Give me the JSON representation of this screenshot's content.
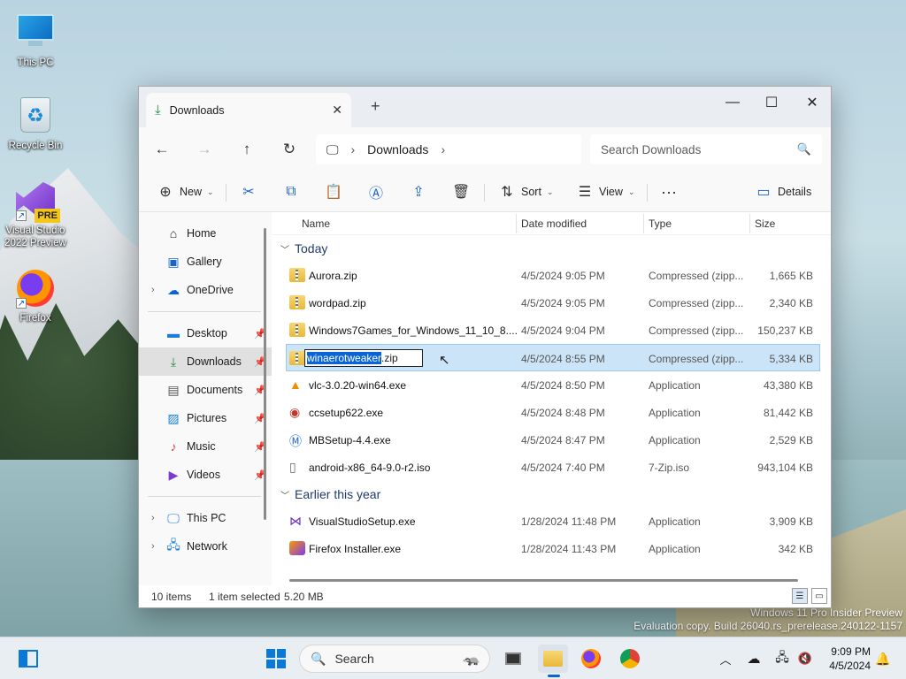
{
  "desktop": {
    "icons": [
      {
        "label": "This PC"
      },
      {
        "label": "Recycle Bin"
      },
      {
        "label": "Visual Studio 2022 Preview",
        "badge": "PRE"
      },
      {
        "label": "Firefox"
      }
    ],
    "watermark": {
      "line1": "Windows 11 Pro Insider Preview",
      "line2": "Evaluation copy. Build 26040.rs_prerelease.240122-1157"
    }
  },
  "window": {
    "tab_title": "Downloads",
    "address": {
      "crumb": "Downloads"
    },
    "search": {
      "placeholder": "Search Downloads"
    },
    "commands": {
      "new": "New",
      "sort": "Sort",
      "view": "View",
      "details": "Details"
    },
    "nav": {
      "home": "Home",
      "gallery": "Gallery",
      "onedrive": "OneDrive",
      "desktop": "Desktop",
      "downloads": "Downloads",
      "documents": "Documents",
      "pictures": "Pictures",
      "music": "Music",
      "videos": "Videos",
      "thispc": "This PC",
      "network": "Network"
    },
    "columns": {
      "name": "Name",
      "date": "Date modified",
      "type": "Type",
      "size": "Size"
    },
    "groups": {
      "today": "Today",
      "earlier": "Earlier this year"
    },
    "files_today": [
      {
        "name": "Aurora.zip",
        "date": "4/5/2024 9:05 PM",
        "type": "Compressed (zipp...",
        "size": "1,665 KB",
        "icon": "zip-icon"
      },
      {
        "name": "wordpad.zip",
        "date": "4/5/2024 9:05 PM",
        "type": "Compressed (zipp...",
        "size": "2,340 KB",
        "icon": "zip-icon"
      },
      {
        "name": "Windows7Games_for_Windows_11_10_8....",
        "date": "4/5/2024 9:04 PM",
        "type": "Compressed (zipp...",
        "size": "150,237 KB",
        "icon": "zip-icon"
      },
      {
        "name_selected_part": "winaerotweaker",
        "name_rest": ".zip",
        "date": "4/5/2024 8:55 PM",
        "type": "Compressed (zipp...",
        "size": "5,334 KB",
        "icon": "zip-icon"
      },
      {
        "name": "vlc-3.0.20-win64.exe",
        "date": "4/5/2024 8:50 PM",
        "type": "Application",
        "size": "43,380 KB",
        "icon": "vlc-icon"
      },
      {
        "name": "ccsetup622.exe",
        "date": "4/5/2024 8:48 PM",
        "type": "Application",
        "size": "81,442 KB",
        "icon": "ccleaner-icon"
      },
      {
        "name": "MBSetup-4.4.exe",
        "date": "4/5/2024 8:47 PM",
        "type": "Application",
        "size": "2,529 KB",
        "icon": "malwarebytes-icon"
      },
      {
        "name": "android-x86_64-9.0-r2.iso",
        "date": "4/5/2024 7:40 PM",
        "type": "7-Zip.iso",
        "size": "943,104 KB",
        "icon": "iso-file-icon"
      }
    ],
    "files_earlier": [
      {
        "name": "VisualStudioSetup.exe",
        "date": "1/28/2024 11:48 PM",
        "type": "Application",
        "size": "3,909 KB",
        "icon": "visual-studio-icon"
      },
      {
        "name": "Firefox Installer.exe",
        "date": "1/28/2024 11:43 PM",
        "type": "Application",
        "size": "342 KB",
        "icon": "firefox-icon"
      }
    ],
    "status": {
      "count": "10 items",
      "selected": "1 item selected",
      "size": "5.20 MB"
    }
  },
  "taskbar": {
    "search_label": "Search",
    "time": "9:09 PM",
    "date": "4/5/2024"
  },
  "colors": {
    "accent": "#0a64d6",
    "selection": "#cce4f7"
  }
}
